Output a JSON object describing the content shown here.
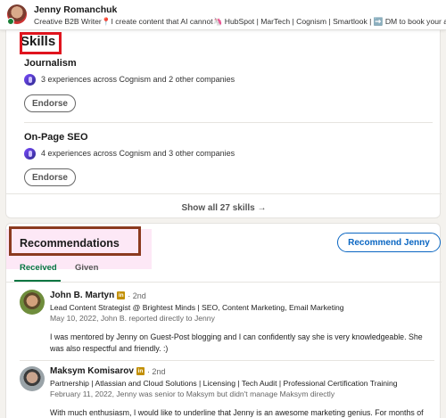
{
  "header": {
    "name": "Jenny Romanchuk",
    "headline": "Creative B2B Writer📍I create content that AI cannot🦄 HubSpot | MarTech | Cognism | Smartlook | ➡️ DM to book your article."
  },
  "skills": {
    "title": "Skills",
    "items": [
      {
        "name": "Journalism",
        "experience": "3 experiences across Cognism and 2 other companies",
        "endorse_label": "Endorse"
      },
      {
        "name": "On-Page SEO",
        "experience": "4 experiences across Cognism and 3 other companies",
        "endorse_label": "Endorse"
      }
    ],
    "show_all": "Show all 27 skills →"
  },
  "recommendations": {
    "title": "Recommendations",
    "recommend_button": "Recommend Jenny",
    "tabs": [
      {
        "label": "Received"
      },
      {
        "label": "Given"
      }
    ],
    "items": [
      {
        "name": "John B. Martyn",
        "degree": "· 2nd",
        "title": "Lead Content Strategist @ Brightest Minds | SEO, Content Marketing, Email Marketing",
        "meta": "May 10, 2022, John B. reported directly to Jenny",
        "text": "I was mentored by Jenny on Guest-Post blogging and I can confidently say she is very knowledgeable. She was also respectful and friendly. :)"
      },
      {
        "name": "Maksym Komisarov",
        "degree": "· 2nd",
        "title": "Partnership | Atlassian and Cloud Solutions | Licensing | Tech Audit | Professional Certification Training",
        "meta": "February 11, 2022, Jenny was senior to Maksym but didn't manage Maksym directly",
        "text": "With much enthusiasm, I would like to underline that Jenny is an awesome marketing genius. For months of"
      }
    ]
  },
  "colors": {
    "accent": "#0a66c2",
    "active_tab": "#057642",
    "skills_highlight": "#e0141e",
    "recommendations_highlight": "#8b3a1f"
  }
}
